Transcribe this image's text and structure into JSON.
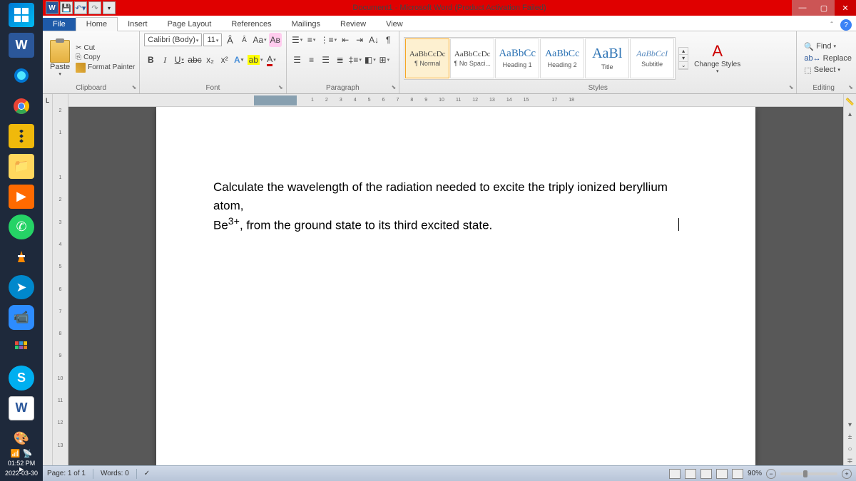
{
  "taskbar": {
    "time": "01:52 PM",
    "date": "2022-03-30"
  },
  "titlebar": {
    "title": "Document1 - Microsoft Word (Product Activation Failed)"
  },
  "tabs": {
    "file": "File",
    "items": [
      "Home",
      "Insert",
      "Page Layout",
      "References",
      "Mailings",
      "Review",
      "View"
    ],
    "active": 0
  },
  "ribbon": {
    "clipboard": {
      "label": "Clipboard",
      "paste": "Paste",
      "cut": "Cut",
      "copy": "Copy",
      "format_painter": "Format Painter"
    },
    "font": {
      "label": "Font",
      "name": "Calibri (Body)",
      "size": "11"
    },
    "paragraph": {
      "label": "Paragraph"
    },
    "styles": {
      "label": "Styles",
      "items": [
        {
          "preview": "AaBbCcDc",
          "name": "¶ Normal",
          "size": "11px"
        },
        {
          "preview": "AaBbCcDc",
          "name": "¶ No Spaci...",
          "size": "11px"
        },
        {
          "preview": "AaBbCc",
          "name": "Heading 1",
          "size": "15px",
          "color": "#2e74b5"
        },
        {
          "preview": "AaBbCc",
          "name": "Heading 2",
          "size": "14px",
          "color": "#2e74b5"
        },
        {
          "preview": "AaBl",
          "name": "Title",
          "size": "20px",
          "color": "#2e74b5"
        },
        {
          "preview": "AaBbCcI",
          "name": "Subtitle",
          "size": "12px",
          "color": "#5a8bbf",
          "style": "italic"
        }
      ],
      "change": "Change Styles"
    },
    "editing": {
      "label": "Editing",
      "find": "Find",
      "replace": "Replace",
      "select": "Select"
    }
  },
  "document": {
    "line1": "Calculate the wavelength of the radiation needed to excite the triply ionized beryllium atom,",
    "line2_pre": "Be",
    "line2_sup": "3+",
    "line2_post": ", from the ground state to its third excited state."
  },
  "status": {
    "page": "Page: 1 of 1",
    "words": "Words: 0",
    "zoom": "90%"
  }
}
